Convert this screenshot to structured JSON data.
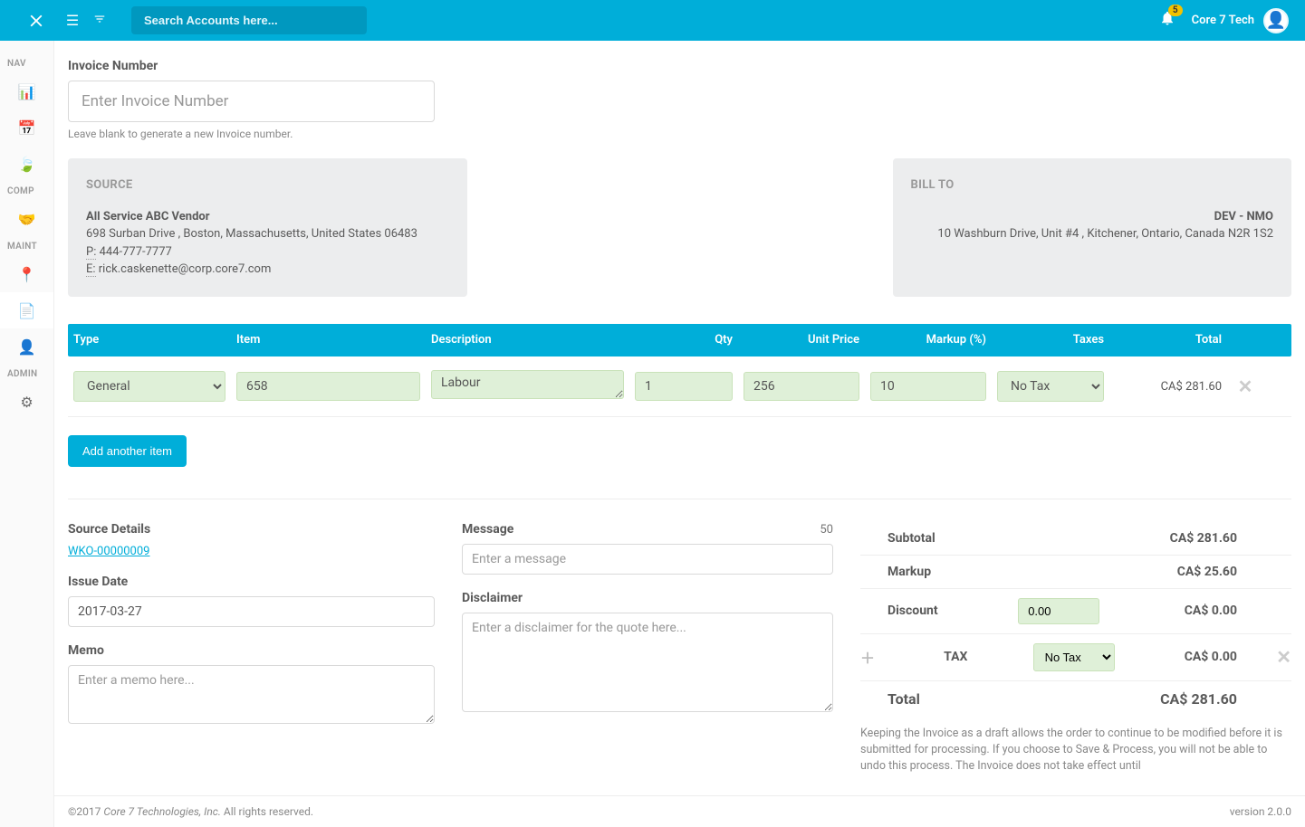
{
  "header": {
    "search_placeholder": "Search Accounts here...",
    "notif_count": "5",
    "user_name": "Core 7 Tech"
  },
  "sidebar": {
    "groups": [
      "NAV",
      "COMP",
      "MAINT",
      "ADMIN"
    ]
  },
  "invoice_number": {
    "label": "Invoice Number",
    "placeholder": "Enter Invoice Number",
    "helper": "Leave blank to generate a new Invoice number."
  },
  "source_card": {
    "title": "SOURCE",
    "name": "All Service ABC Vendor",
    "address": "698 Surban Drive , Boston, Massachusetts, United States 06483",
    "phone_label": "P:",
    "phone": "444-777-7777",
    "email_label": "E:",
    "email": "rick.caskenette@corp.core7.com"
  },
  "billto_card": {
    "title": "BILL TO",
    "name": "DEV - NMO",
    "address": "10 Washburn Drive, Unit #4 , Kitchener, Ontario, Canada N2R 1S2"
  },
  "items_header": {
    "type": "Type",
    "item": "Item",
    "description": "Description",
    "qty": "Qty",
    "unit_price": "Unit Price",
    "markup": "Markup (%)",
    "taxes": "Taxes",
    "total": "Total"
  },
  "line_item": {
    "type": "General",
    "item": "658",
    "description": "Labour",
    "qty": "1",
    "unit_price": "256",
    "markup": "10",
    "taxes": "No Tax",
    "total": "CA$ 281.60"
  },
  "add_item_label": "Add another item",
  "lower_left": {
    "source_details_label": "Source Details",
    "source_details_link": "WKO-00000009",
    "issue_date_label": "Issue Date",
    "issue_date_value": "2017-03-27",
    "memo_label": "Memo",
    "memo_placeholder": "Enter a memo here..."
  },
  "lower_mid": {
    "message_label": "Message",
    "message_counter": "50",
    "message_placeholder": "Enter a message",
    "disclaimer_label": "Disclaimer",
    "disclaimer_placeholder": "Enter a disclaimer for the quote here..."
  },
  "totals": {
    "subtotal_label": "Subtotal",
    "subtotal_value": "CA$ 281.60",
    "markup_label": "Markup",
    "markup_value": "CA$ 25.60",
    "discount_label": "Discount",
    "discount_input": "0.00",
    "discount_value": "CA$ 0.00",
    "tax_label": "TAX",
    "tax_select": "No Tax",
    "tax_value": "CA$ 0.00",
    "total_label": "Total",
    "total_value": "CA$ 281.60"
  },
  "draft_note": "Keeping the Invoice as a draft allows the order to continue to be modified before it is submitted for processing. If you choose to Save & Process, you will not be able to undo this process. The Invoice does not take effect until",
  "footer": {
    "copyright_prefix": "©2017 ",
    "company": "Core 7 Technologies, Inc.",
    "copyright_suffix": " All rights reserved.",
    "version": "version 2.0.0"
  }
}
